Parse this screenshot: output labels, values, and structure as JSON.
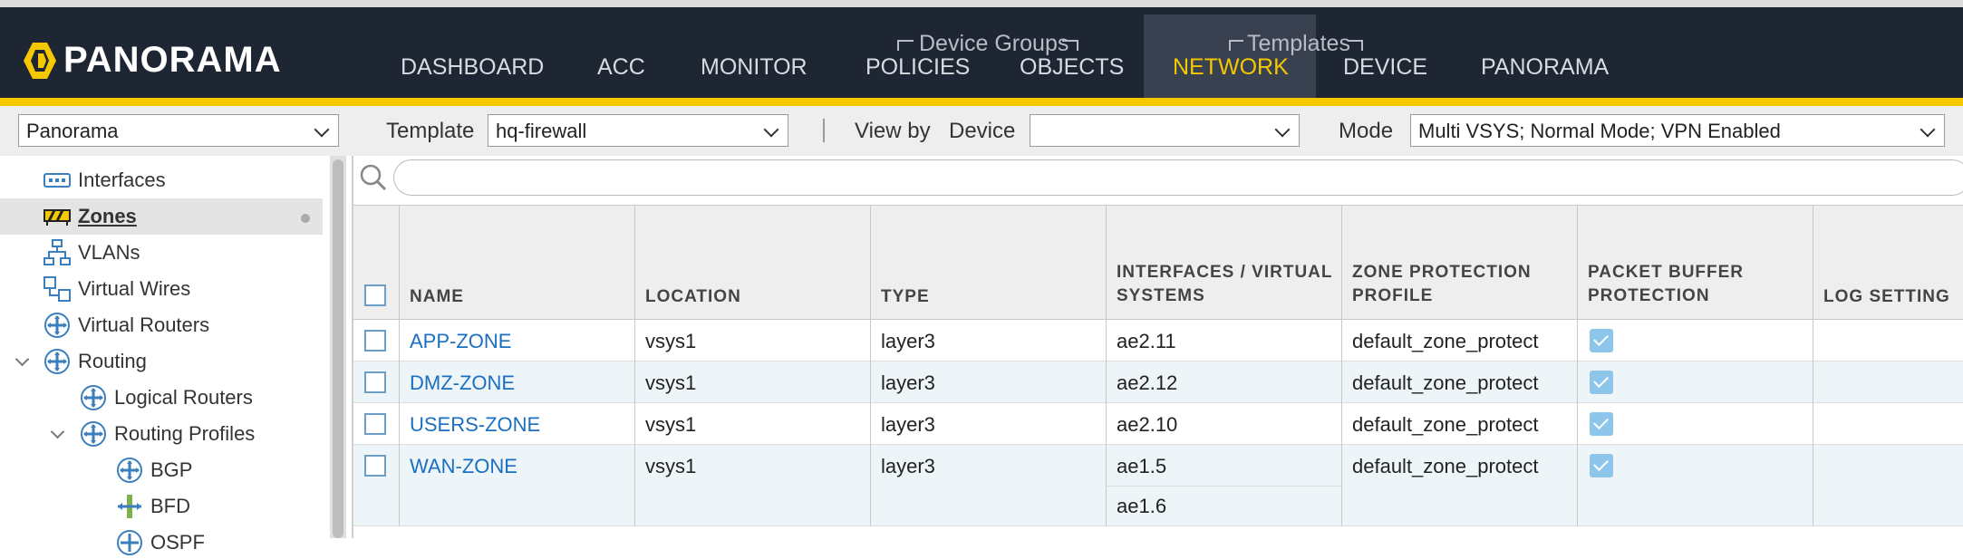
{
  "app": {
    "logo_text": "PANORAMA",
    "accent_color": "#f5c800",
    "header_color": "#1e2533"
  },
  "nav": {
    "group_device_groups": "Device Groups",
    "group_templates": "Templates",
    "items": [
      {
        "label": "DASHBOARD",
        "active": false
      },
      {
        "label": "ACC",
        "active": false
      },
      {
        "label": "MONITOR",
        "active": false
      },
      {
        "label": "POLICIES",
        "active": false
      },
      {
        "label": "OBJECTS",
        "active": false
      },
      {
        "label": "NETWORK",
        "active": true
      },
      {
        "label": "DEVICE",
        "active": false
      },
      {
        "label": "PANORAMA",
        "active": false
      }
    ]
  },
  "toolbar": {
    "context_value": "Panorama",
    "template_label": "Template",
    "template_value": "hq-firewall",
    "viewby_label": "View by",
    "device_label": "Device",
    "device_value": "",
    "mode_label": "Mode",
    "mode_value": "Multi VSYS; Normal Mode; VPN Enabled"
  },
  "sidebar": {
    "items": [
      {
        "label": "Interfaces",
        "icon": "interfaces-icon"
      },
      {
        "label": "Zones",
        "icon": "zones-icon",
        "selected": true
      },
      {
        "label": "VLANs",
        "icon": "vlans-icon"
      },
      {
        "label": "Virtual Wires",
        "icon": "virtual-wires-icon"
      },
      {
        "label": "Virtual Routers",
        "icon": "virtual-router-icon"
      },
      {
        "label": "Routing",
        "icon": "router-icon",
        "expanded": true
      },
      {
        "label": "Logical Routers",
        "icon": "router-icon"
      },
      {
        "label": "Routing Profiles",
        "icon": "router-icon",
        "expanded": true
      },
      {
        "label": "BGP",
        "icon": "bgp-icon"
      },
      {
        "label": "BFD",
        "icon": "bfd-icon"
      },
      {
        "label": "OSPF",
        "icon": "ospf-icon"
      }
    ]
  },
  "search": {
    "placeholder": ""
  },
  "table": {
    "columns": {
      "name": "NAME",
      "location": "LOCATION",
      "type": "TYPE",
      "interfaces_1": "INTERFACES / VIRTUAL",
      "interfaces_2": "SYSTEMS",
      "zpp_1": "ZONE PROTECTION",
      "zpp_2": "PROFILE",
      "pbp_1": "PACKET BUFFER",
      "pbp_2": "PROTECTION",
      "log": "LOG SETTING"
    },
    "rows": [
      {
        "name": "APP-ZONE",
        "location": "vsys1",
        "type": "layer3",
        "interfaces": [
          "ae2.11"
        ],
        "zone_protection_profile": "default_zone_protect",
        "packet_buffer_protection": true
      },
      {
        "name": "DMZ-ZONE",
        "location": "vsys1",
        "type": "layer3",
        "interfaces": [
          "ae2.12"
        ],
        "zone_protection_profile": "default_zone_protect",
        "packet_buffer_protection": true
      },
      {
        "name": "USERS-ZONE",
        "location": "vsys1",
        "type": "layer3",
        "interfaces": [
          "ae2.10"
        ],
        "zone_protection_profile": "default_zone_protect",
        "packet_buffer_protection": true
      },
      {
        "name": "WAN-ZONE",
        "location": "vsys1",
        "type": "layer3",
        "interfaces": [
          "ae1.5",
          "ae1.6"
        ],
        "zone_protection_profile": "default_zone_protect",
        "packet_buffer_protection": true
      }
    ]
  }
}
